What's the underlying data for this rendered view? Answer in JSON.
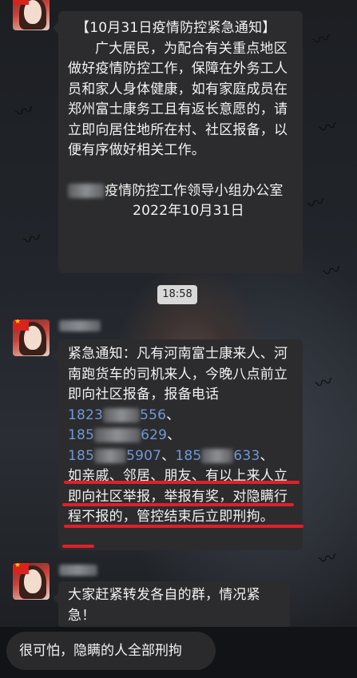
{
  "messages": [
    {
      "title": "【10月31日疫情防控紧急通知】",
      "body": "广大居民，为配合有关重点地区做好疫情防控工作，保障在外务工人员和家人身体健康，如有家庭成员在郑州富士康务工且有返长意愿的，请立即向居住地所在村、社区报备，以便有序做好相关工作。",
      "signature_suffix": "疫情防控工作领导小组办公室",
      "date": "2022年10月31日"
    },
    {
      "intro": "紧急通知：凡有河南富士康来人、河南跑货车的司机来人，今晚八点前立即向社区报备，报备电话",
      "phones": [
        {
          "prefix": "1823",
          "suffix": "556"
        },
        {
          "prefix": "185",
          "suffix": "629"
        },
        {
          "prefix": "185",
          "suffix": "5907"
        },
        {
          "prefix": "185",
          "suffix": "633"
        }
      ],
      "separator": "、",
      "warning": "如亲戚、邻居、朋友、有以上来人立即向社区举报，举报有奖，对隐瞒行程不报的，管控结束后立即刑拘。"
    },
    {
      "text": "大家赶紧转发各自的群，情况紧急！"
    }
  ],
  "timestamp": "18:58",
  "reply": {
    "text": "很可怕，隐瞒的人全部刑拘"
  },
  "colors": {
    "bubble": "#2c2c2e",
    "highlight_underline": "#e0202a",
    "phone_link": "#6f99d6",
    "time_pill": "#d9d9d9"
  }
}
